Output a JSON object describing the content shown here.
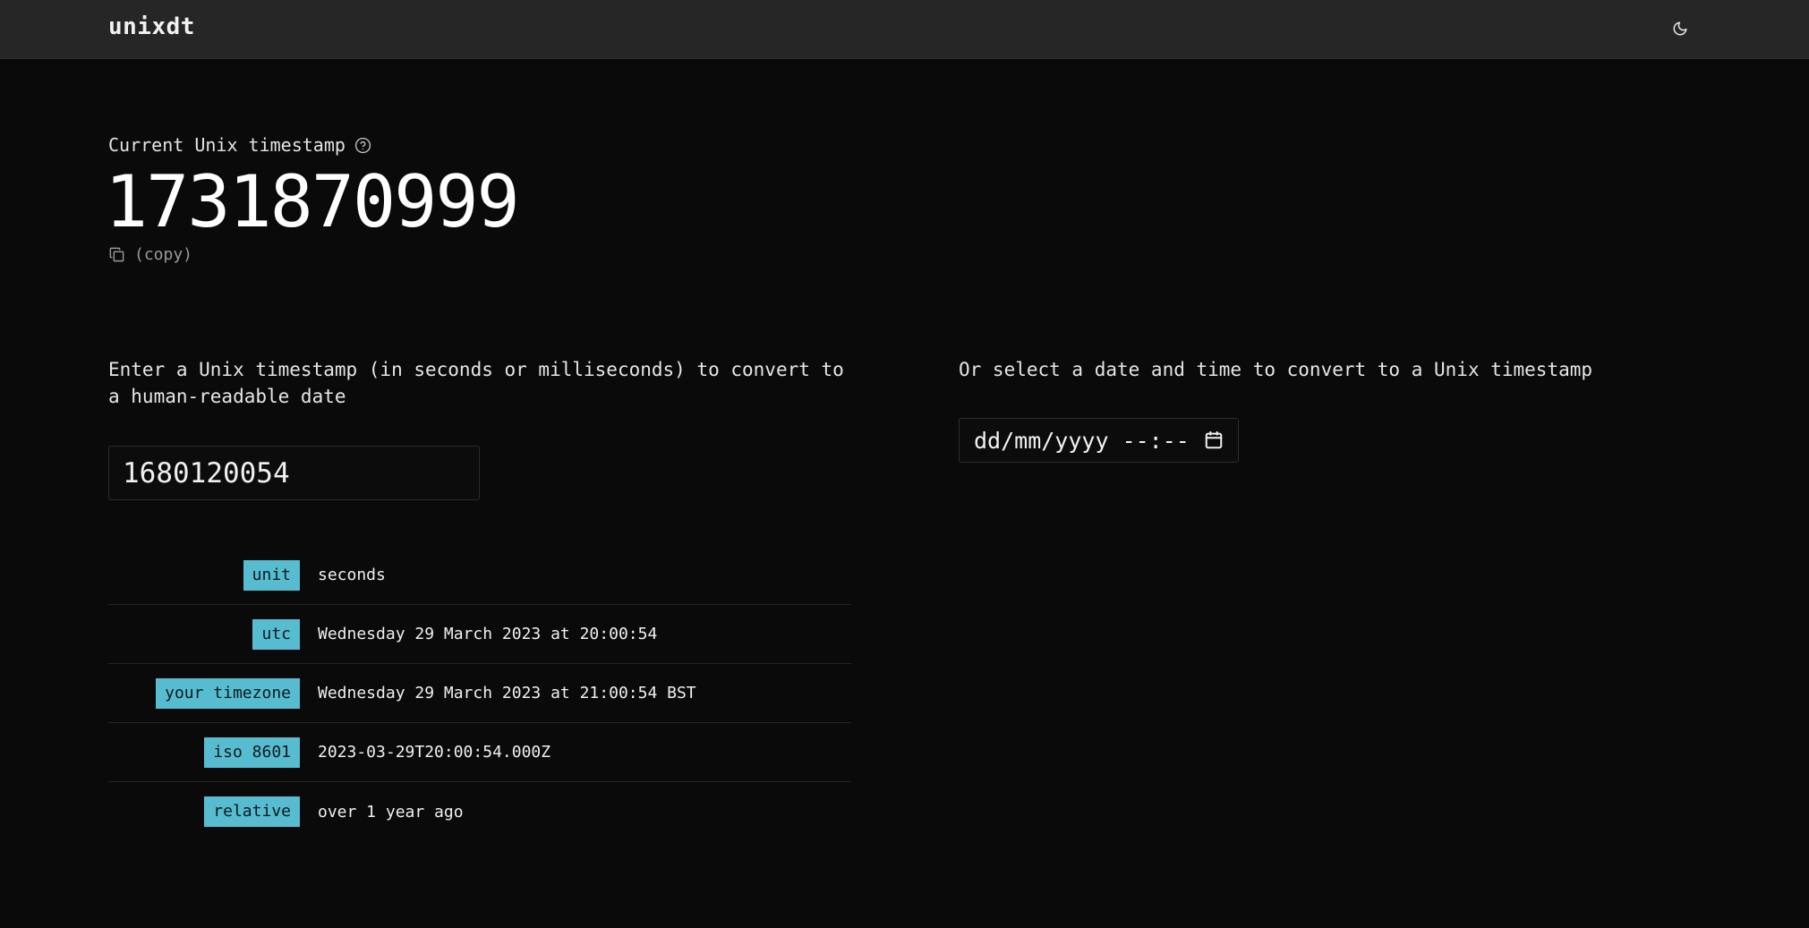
{
  "header": {
    "brand": "unixdt",
    "theme_icon": "moon-icon"
  },
  "current": {
    "label": "Current Unix timestamp",
    "help_icon": "help-circle-icon",
    "value": "1731870999",
    "copy_label": "(copy)",
    "copy_icon": "copy-icon"
  },
  "converter": {
    "instructions": "Enter a Unix timestamp (in seconds or milliseconds) to convert to a human-readable date",
    "input_value": "1680120054",
    "rows": [
      {
        "label": "unit",
        "value": "seconds"
      },
      {
        "label": "utc",
        "value": "Wednesday 29 March 2023 at 20:00:54"
      },
      {
        "label": "your timezone",
        "value": "Wednesday 29 March 2023 at 21:00:54 BST"
      },
      {
        "label": "iso 8601",
        "value": "2023-03-29T20:00:54.000Z"
      },
      {
        "label": "relative",
        "value": "over 1 year ago"
      }
    ]
  },
  "date_picker": {
    "instructions": "Or select a date and time to convert to a Unix timestamp",
    "placeholder": "dd/mm/yyyy --:--",
    "calendar_icon": "calendar-icon"
  },
  "colors": {
    "tag_bg": "#57bcd0",
    "header_bg": "#262627",
    "page_bg": "#0a0a0b"
  }
}
